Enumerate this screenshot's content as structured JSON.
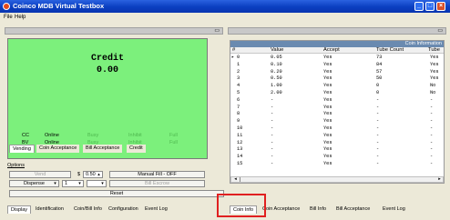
{
  "window": {
    "title": "Coinco MDB Virtual Testbox"
  },
  "menu": [
    "File",
    "Help"
  ],
  "display": {
    "credit_label": "Credit",
    "credit_value": "0.00",
    "status_rows": [
      {
        "name": "CC",
        "state": "Online",
        "c3": "Busy",
        "c4": "Inhibit",
        "c5": "Full"
      },
      {
        "name": "BV",
        "state": "Online",
        "c3": "Busy",
        "c4": "Inhibit",
        "c5": "Full"
      }
    ]
  },
  "left_tabs": [
    "Vending",
    "Coin Acceptance",
    "Bill Acceptance",
    "Credit"
  ],
  "options": {
    "label": "Options",
    "vend_label": "Vend",
    "price_prefix": "$",
    "price_value": "0.50",
    "manual_fill_label": "Manual Fill - OFF",
    "dispense_label": "Dispense",
    "dispense_value": "1",
    "bill_escrow_label": "Bill Escrow",
    "reset_label": "Reset"
  },
  "bottom_tabs_left": [
    "Display",
    "Identification",
    "Coin/Bill Info",
    "Configuration",
    "Event Log"
  ],
  "coin_table": {
    "banner": "Coin Information",
    "columns": [
      "#",
      "Value",
      "Accept",
      "Tube Count",
      "Tube"
    ],
    "rows": [
      [
        "0",
        "0.05",
        "Yes",
        "73",
        "Yes"
      ],
      [
        "1",
        "0.10",
        "Yes",
        "84",
        "Yes"
      ],
      [
        "2",
        "0.20",
        "Yes",
        "57",
        "Yes"
      ],
      [
        "3",
        "0.50",
        "Yes",
        "50",
        "Yes"
      ],
      [
        "4",
        "1.00",
        "Yes",
        "0",
        "No"
      ],
      [
        "5",
        "2.00",
        "Yes",
        "0",
        "No"
      ],
      [
        "6",
        "-",
        "Yes",
        "-",
        "-"
      ],
      [
        "7",
        "-",
        "Yes",
        "-",
        "-"
      ],
      [
        "8",
        "-",
        "Yes",
        "-",
        "-"
      ],
      [
        "9",
        "-",
        "Yes",
        "-",
        "-"
      ],
      [
        "10",
        "-",
        "Yes",
        "-",
        "-"
      ],
      [
        "11",
        "-",
        "Yes",
        "-",
        "-"
      ],
      [
        "12",
        "-",
        "Yes",
        "-",
        "-"
      ],
      [
        "13",
        "-",
        "Yes",
        "-",
        "-"
      ],
      [
        "14",
        "-",
        "Yes",
        "-",
        "-"
      ],
      [
        "15",
        "-",
        "Yes",
        "-",
        "-"
      ]
    ],
    "selected_row": 0
  },
  "bottom_tabs_right": [
    "Coin Info",
    "Coin Acceptance",
    "Bill Info",
    "Bill Acceptance",
    "Event Log"
  ],
  "colors": {
    "display_green": "#7cf07c",
    "highlight_red": "#e02020",
    "title_blue": "#0a3fc0"
  }
}
